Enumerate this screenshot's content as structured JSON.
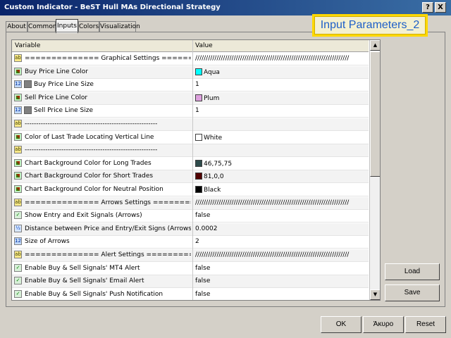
{
  "window": {
    "title": "Custom Indicator - BeST Hull MAs Directional Strategy",
    "help_label": "?",
    "close_label": "X"
  },
  "tabs": [
    {
      "label": "About"
    },
    {
      "label": "Common"
    },
    {
      "label": "Inputs",
      "active": true
    },
    {
      "label": "Colors"
    },
    {
      "label": "Visualization"
    }
  ],
  "banner": {
    "text": "Input Parameters_2"
  },
  "grid": {
    "headers": {
      "variable": "Variable",
      "value": "Value"
    },
    "rows": [
      {
        "icon": "ab-icon",
        "variable": "============== Graphical Settings ========================",
        "value": "////////////////////////////////////////////////////////////////////////"
      },
      {
        "icon": "color-icon",
        "variable": "Buy Price Line Color",
        "value": "Aqua",
        "swatch": "#00ffff"
      },
      {
        "icon": "int-icon",
        "sub": true,
        "variable": "Buy Price Line Size",
        "value": "1"
      },
      {
        "icon": "color-icon",
        "variable": "Sell Price Line Color",
        "value": "Plum",
        "swatch": "#dda0dd"
      },
      {
        "icon": "int-icon",
        "sub": true,
        "variable": "Sell Price Line Size",
        "value": "1"
      },
      {
        "icon": "ab-icon",
        "variable": "----------------------------------------------------------",
        "value": ""
      },
      {
        "icon": "color-icon",
        "variable": "Color of Last Trade Locating Vertical Line",
        "value": "White",
        "swatch": "#ffffff"
      },
      {
        "icon": "ab-icon",
        "variable": "----------------------------------------------------------",
        "value": ""
      },
      {
        "icon": "color-icon",
        "variable": "Chart Background Color for Long Trades",
        "value": "46,75,75",
        "swatch": "#2e4b4b"
      },
      {
        "icon": "color-icon",
        "variable": "Chart Background Color for Short Trades",
        "value": "81,0,0",
        "swatch": "#510000"
      },
      {
        "icon": "color-icon",
        "variable": "Chart Background Color for Neutral Position",
        "value": "Black",
        "swatch": "#000000"
      },
      {
        "icon": "ab-icon",
        "variable": "============== Arrows Settings ============================",
        "value": "////////////////////////////////////////////////////////////////////////"
      },
      {
        "icon": "bool-icon",
        "variable": "Show Entry and Exit Signals (Arrows)",
        "value": "false"
      },
      {
        "icon": "double-icon",
        "variable": "Distance between Price and Entry/Exit Signs (Arrows)",
        "value": "0.0002"
      },
      {
        "icon": "int-icon",
        "variable": "Size of Arrows",
        "value": "2"
      },
      {
        "icon": "ab-icon",
        "variable": "============== Alert Settings ===============================",
        "value": "////////////////////////////////////////////////////////////////////////"
      },
      {
        "icon": "bool-icon",
        "variable": "Enable Buy & Sell Signals'  MT4 Alert",
        "value": "false"
      },
      {
        "icon": "bool-icon",
        "variable": "Enable Buy & Sell Signals'  Email Alert",
        "value": "false"
      },
      {
        "icon": "bool-icon",
        "variable": "Enable Buy & Sell Signals'  Push Notification",
        "value": "false"
      }
    ]
  },
  "side_buttons": {
    "load": "Load",
    "save": "Save"
  },
  "footer_buttons": {
    "ok": "OK",
    "cancel": "Άκυρο",
    "reset": "Reset"
  }
}
